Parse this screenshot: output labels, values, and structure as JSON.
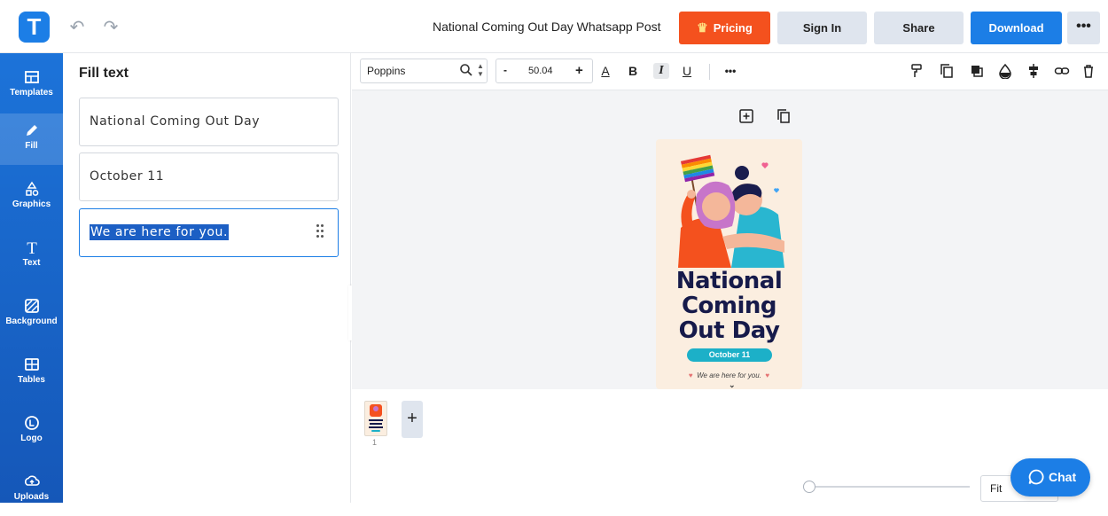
{
  "header": {
    "logo_letter": "T",
    "doc_title": "National Coming Out Day Whatsapp Post",
    "pricing_label": "Pricing",
    "signin_label": "Sign In",
    "share_label": "Share",
    "download_label": "Download",
    "more_label": "•••"
  },
  "sidebar": {
    "items": [
      {
        "label": "Templates",
        "icon": "templates-icon"
      },
      {
        "label": "Fill",
        "icon": "pencil-icon"
      },
      {
        "label": "Graphics",
        "icon": "shapes-icon"
      },
      {
        "label": "Text",
        "icon": "text-icon"
      },
      {
        "label": "Background",
        "icon": "background-icon"
      },
      {
        "label": "Tables",
        "icon": "table-icon"
      },
      {
        "label": "Logo",
        "icon": "logo-icon"
      },
      {
        "label": "Uploads",
        "icon": "upload-cloud-icon"
      }
    ]
  },
  "panel": {
    "title": "Fill text",
    "fields": [
      {
        "value": "National Coming Out Day"
      },
      {
        "value": "October 11"
      },
      {
        "value": "We are here for you."
      }
    ]
  },
  "toolbar": {
    "font_name": "Poppins",
    "font_size": "50.04",
    "minus_label": "-",
    "plus_label": "+",
    "bold_label": "B",
    "italic_label": "I",
    "underline_label": "U",
    "color_label": "A",
    "more_label": "•••"
  },
  "poster": {
    "title_lines": [
      "National",
      "Coming",
      "Out Day"
    ],
    "date": "October 11",
    "tagline": "We are here for you."
  },
  "pages": {
    "page_number": "1",
    "add_label": "+"
  },
  "zoom": {
    "fit_label": "Fit",
    "level": 0.0
  },
  "chat": {
    "label": "Chat"
  },
  "colors": {
    "brand_blue": "#1c7ee6",
    "pricing_orange": "#f4511e",
    "poster_bg": "#fbeee0",
    "poster_text": "#161a4a",
    "date_pill": "#1cb0c8"
  }
}
